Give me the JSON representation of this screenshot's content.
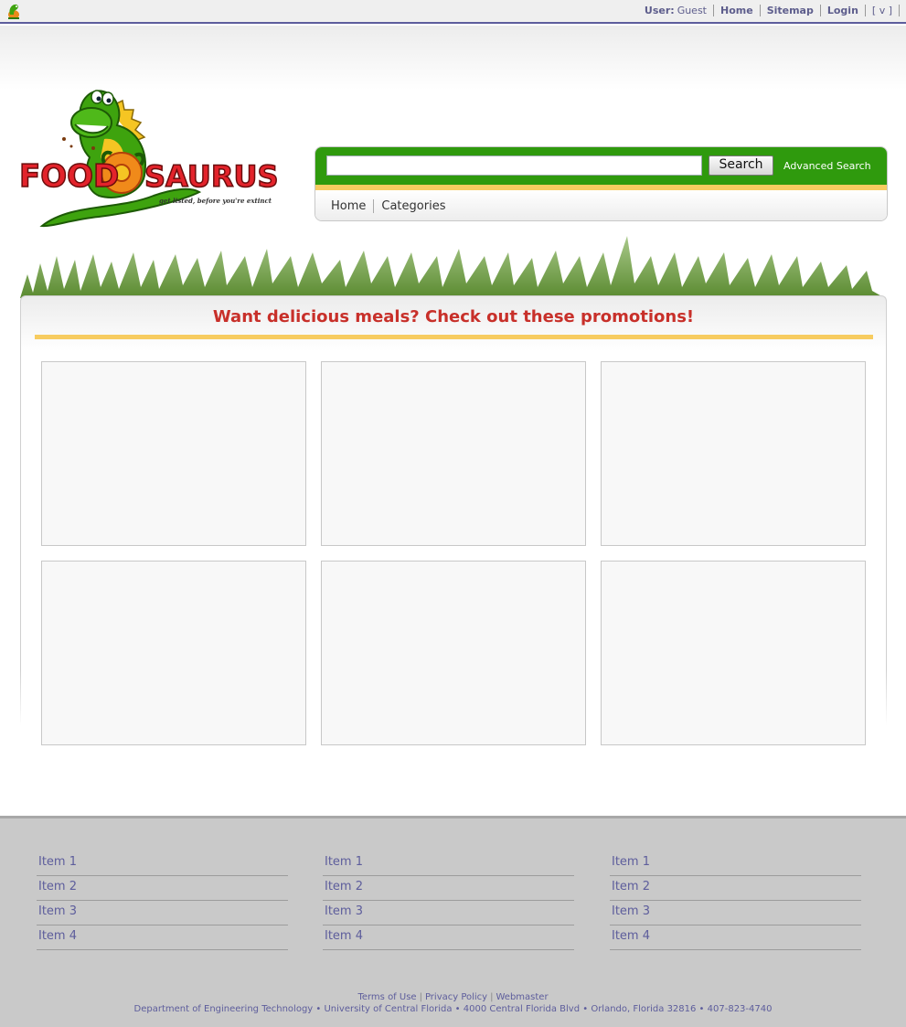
{
  "topbar": {
    "user_label": "User:",
    "user_value": "Guest",
    "links": [
      "Home",
      "Sitemap",
      "Login",
      "[ v ]"
    ]
  },
  "logo": {
    "word_left": "FOOD",
    "word_right": "SAURUS",
    "tagline": "get listed, before you're extinct"
  },
  "search": {
    "button_label": "Search",
    "advanced_label": "Advanced Search",
    "input_value": ""
  },
  "nav": {
    "items": [
      "Home",
      "Categories"
    ]
  },
  "main": {
    "promo_title": "Want delicious meals? Check out these promotions!"
  },
  "footer": {
    "columns": [
      [
        "Item 1",
        "Item 2",
        "Item 3",
        "Item 4"
      ],
      [
        "Item 1",
        "Item 2",
        "Item 3",
        "Item 4"
      ],
      [
        "Item 1",
        "Item 2",
        "Item 3",
        "Item 4"
      ]
    ],
    "links": [
      "Terms of Use",
      "Privacy Policy",
      "Webmaster"
    ],
    "address": "Department of Engineering Technology • University of Central Florida • 4000 Central Florida Blvd • Orlando, Florida 32816 • 407-823-4740"
  },
  "colors": {
    "accent_green": "#2f9a0d",
    "accent_yellow": "#f7cc60",
    "title_red": "#c8302a",
    "link_purple": "#5d5d9c"
  }
}
